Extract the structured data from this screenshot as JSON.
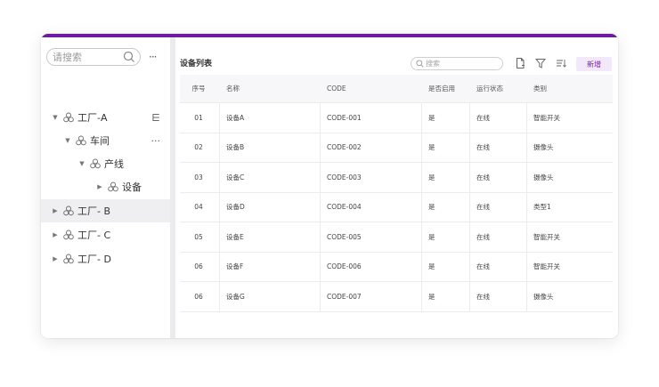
{
  "colors": {
    "accent": "#6e1aa3",
    "add_button_bg": "#f3e7fa",
    "add_button_text": "#7c1fb0"
  },
  "sidebar": {
    "search_placeholder": "请搜索",
    "more_label": "···",
    "tree": [
      {
        "label": "工厂-A",
        "action": "⋿"
      },
      {
        "label": "车间",
        "action": "···"
      },
      {
        "label": "产线"
      },
      {
        "label": "设备"
      },
      {
        "label": "工厂- B"
      },
      {
        "label": "工厂- C"
      },
      {
        "label": "工厂- D"
      }
    ]
  },
  "main": {
    "title": "设备列表",
    "search_placeholder": "搜索",
    "add_label": "新增",
    "columns": [
      "序号",
      "名称",
      "CODE",
      "是否启用",
      "运行状态",
      "类别"
    ],
    "rows": [
      [
        "01",
        "设备A",
        "CODE-001",
        "是",
        "在线",
        "智能开关"
      ],
      [
        "02",
        "设备B",
        "CODE-002",
        "是",
        "在线",
        "摄像头"
      ],
      [
        "03",
        "设备C",
        "CODE-003",
        "是",
        "在线",
        "摄像头"
      ],
      [
        "04",
        "设备D",
        "CODE-004",
        "是",
        "在线",
        "类型1"
      ],
      [
        "05",
        "设备E",
        "CODE-005",
        "是",
        "在线",
        "智能开关"
      ],
      [
        "06",
        "设备F",
        "CODE-006",
        "是",
        "在线",
        "智能开关"
      ],
      [
        "06",
        "设备G",
        "CODE-007",
        "是",
        "在线",
        "摄像头"
      ]
    ]
  }
}
